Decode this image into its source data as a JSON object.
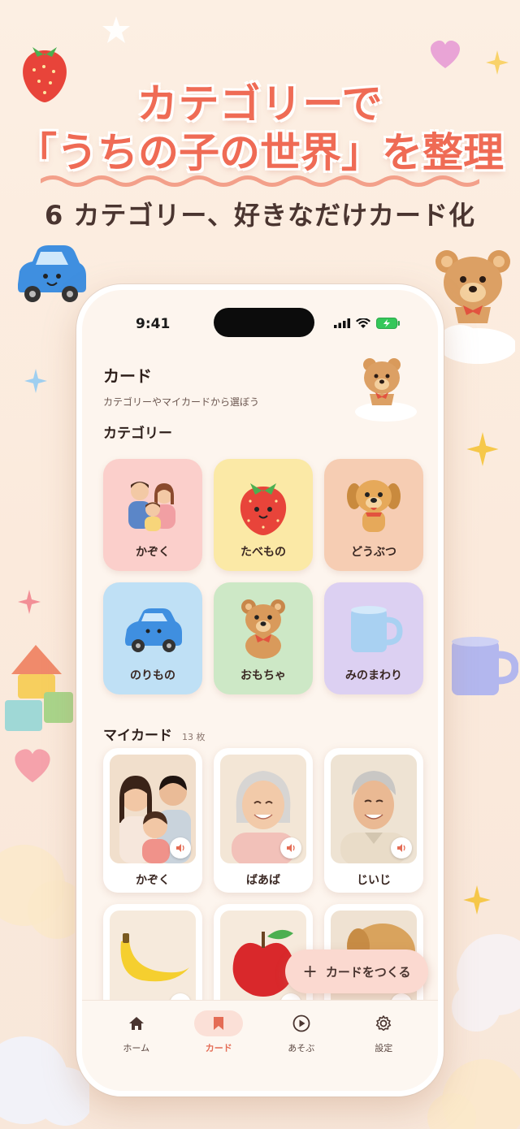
{
  "promo": {
    "line1": "カテゴリーで",
    "line2": "「うちの子の世界」を整理",
    "subtitle": "6 カテゴリー、好きなだけカード化"
  },
  "status": {
    "time": "9:41"
  },
  "page": {
    "title": "カード",
    "subtitle": "カテゴリーやマイカードから選ぼう",
    "category_heading": "カテゴリー",
    "mycards_heading": "マイカード",
    "mycards_count": "13 枚"
  },
  "categories": [
    {
      "label": "かぞく",
      "color": "#fbcfcb",
      "icon": "family-icon"
    },
    {
      "label": "たべもの",
      "color": "#fbe9a6",
      "icon": "strawberry-icon"
    },
    {
      "label": "どうぶつ",
      "color": "#f6cdb3",
      "icon": "puppy-icon"
    },
    {
      "label": "のりもの",
      "color": "#bfe0f5",
      "icon": "car-icon"
    },
    {
      "label": "おもちゃ",
      "color": "#cde8c6",
      "icon": "teddy-bear-icon"
    },
    {
      "label": "みのまわり",
      "color": "#dcd0f2",
      "icon": "mug-icon"
    }
  ],
  "mycards": [
    {
      "label": "かぞく",
      "icon": "family-photo"
    },
    {
      "label": "ばあば",
      "icon": "grandma-photo"
    },
    {
      "label": "じいじ",
      "icon": "grandpa-photo"
    },
    {
      "label": "",
      "icon": "banana-photo"
    },
    {
      "label": "",
      "icon": "apple-photo"
    },
    {
      "label": "",
      "icon": "puppy-photo"
    }
  ],
  "fab": {
    "label": "カードをつくる",
    "plus": "+"
  },
  "tabs": [
    {
      "label": "ホーム",
      "icon": "home-icon",
      "active": false
    },
    {
      "label": "カード",
      "icon": "bookmark-icon",
      "active": true
    },
    {
      "label": "あそぶ",
      "icon": "play-icon",
      "active": false
    },
    {
      "label": "設定",
      "icon": "gear-icon",
      "active": false
    }
  ],
  "colors": {
    "accent": "#ef6b55",
    "tab_active": "#e46c55",
    "phone_bg": "#fdf5ee"
  }
}
